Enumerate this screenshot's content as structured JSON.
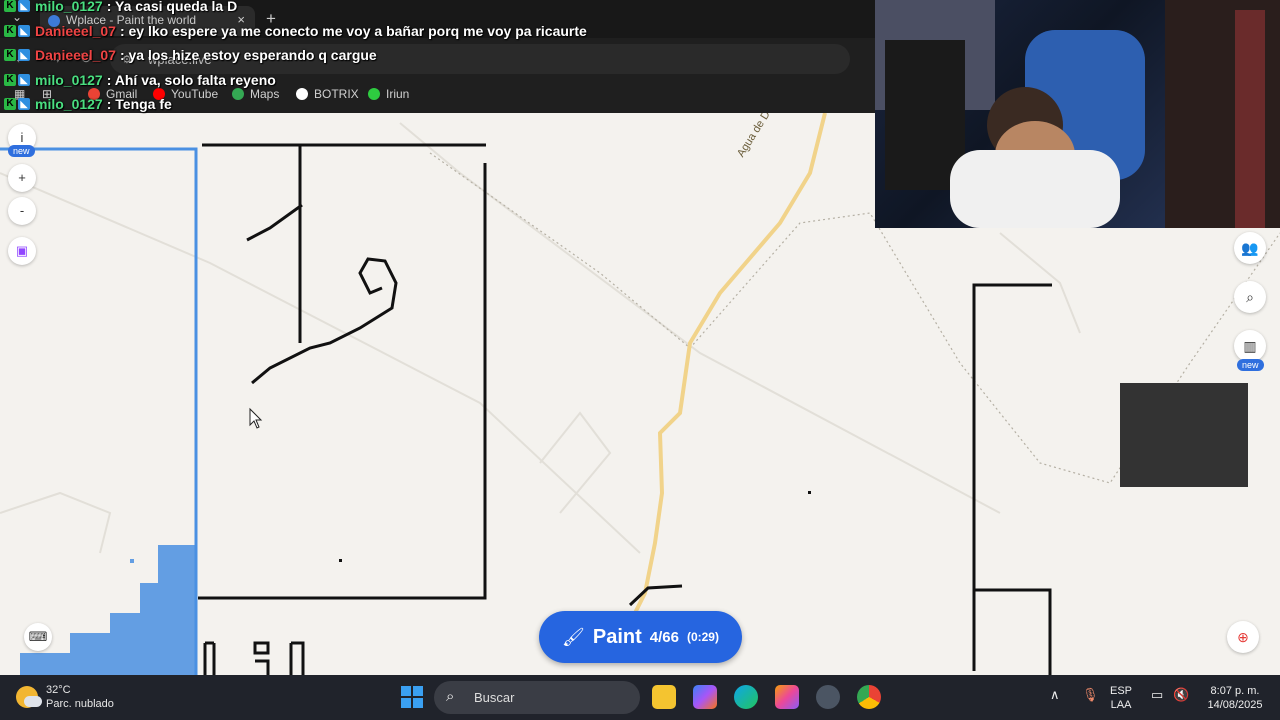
{
  "browser": {
    "tab_title": "Wplace - Paint the world",
    "tab_close": "×",
    "new_tab": "+",
    "url": "wplace.live",
    "bookmarks": [
      {
        "label": "Gmail",
        "icon": "gmail-icon",
        "color": "#ea4335"
      },
      {
        "label": "YouTube",
        "icon": "youtube-icon",
        "color": "#ff0000"
      },
      {
        "label": "Maps",
        "icon": "maps-icon",
        "color": "#34a853"
      },
      {
        "label": "BOTRIX",
        "icon": "botrix-icon",
        "color": "#ffffff"
      },
      {
        "label": "Iriun",
        "icon": "iriun-icon",
        "color": "#2ecc40"
      }
    ]
  },
  "chat": [
    {
      "user": "milo_0127",
      "color": "#4ade80",
      "message": ": Ya casi queda la D"
    },
    {
      "user": "Danieeel_07",
      "color": "#ef4444",
      "message": ": ey lko espere ya me conecto me voy a bañar porq me voy pa ricaurte"
    },
    {
      "user": "Danieeel_07",
      "color": "#ef4444",
      "message": ": ya los hize estoy esperando q cargue"
    },
    {
      "user": "milo_0127",
      "color": "#4ade80",
      "message": ": Ahí va, solo falta reyeno"
    },
    {
      "user": "milo_0127",
      "color": "#4ade80",
      "message": ": Tenga fe"
    }
  ],
  "map": {
    "road_label": "Agua de Dios - Ricaurte - Agua de D",
    "left_tools": [
      {
        "label": "i",
        "icon": "info-icon"
      },
      {
        "label": "+",
        "icon": "zoom-in-icon"
      },
      {
        "label": "-",
        "icon": "zoom-out-icon"
      }
    ],
    "new_badge": "new",
    "right_new_badge": "new"
  },
  "paint": {
    "label": "Paint",
    "count": "4/66",
    "timer": "(0:29)"
  },
  "taskbar": {
    "temperature": "32°C",
    "weather": "Parc. nublado",
    "search_placeholder": "Buscar",
    "lang_top": "ESP",
    "lang_bottom": "LAA",
    "time": "8:07 p. m.",
    "date": "14/08/2025"
  },
  "colors": {
    "accent": "#2665e0",
    "selection": "#4a90e2",
    "taskbar": "#20232b"
  }
}
